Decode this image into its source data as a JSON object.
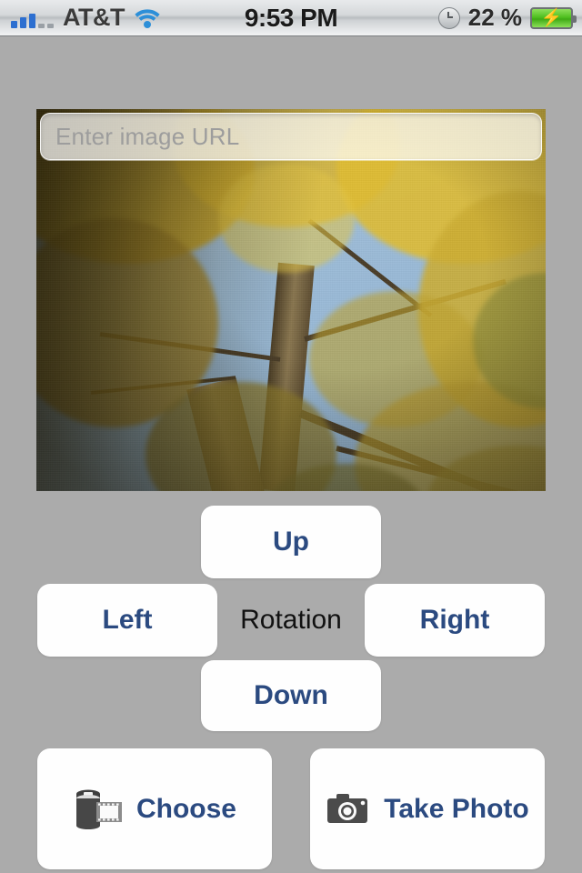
{
  "status_bar": {
    "carrier": "AT&T",
    "signal_icon": "signal-bars-icon",
    "signal_bars_total": 5,
    "signal_bars_filled": 3,
    "wifi_icon": "wifi-icon",
    "time": "9:53 PM",
    "alarm_icon": "clock-icon",
    "battery_percent": "22 %",
    "battery_icon": "battery-charging-icon",
    "battery_color": "#4fbf20",
    "charging": true
  },
  "image_area": {
    "url_input": {
      "value": "",
      "placeholder": "Enter image URL"
    },
    "photo_alt": "Looking up into a ginkgo tree with golden-yellow autumn leaves against blue sky"
  },
  "rotation_controls": {
    "label": "Rotation",
    "up": "Up",
    "left": "Left",
    "right": "Right",
    "down": "Down"
  },
  "source_controls": {
    "choose": {
      "label": "Choose",
      "icon": "film-roll-icon"
    },
    "take_photo": {
      "label": "Take Photo",
      "icon": "camera-icon"
    }
  },
  "theme": {
    "background": "#ababab",
    "button_face": "#fefefe",
    "button_text": "#2b4a80",
    "label_text": "#111111",
    "placeholder_text": "#9d9d9d"
  }
}
